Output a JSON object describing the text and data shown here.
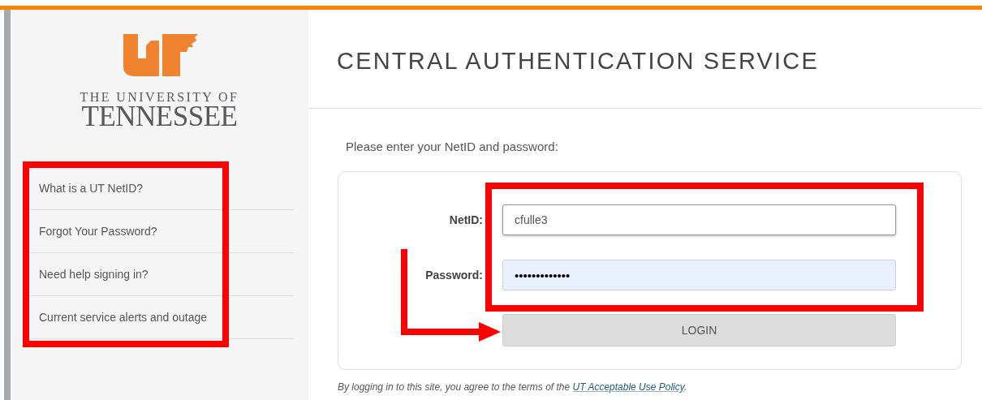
{
  "logo": {
    "line_1": "THE UNIVERSITY OF",
    "line_2": "TENNESSEE"
  },
  "help_links": {
    "highlighted": true,
    "items": [
      {
        "label": "What is a UT NetID?"
      },
      {
        "label": "Forgot Your Password?"
      },
      {
        "label": "Need help signing in?"
      },
      {
        "label": "Current service alerts and outage"
      }
    ]
  },
  "header": {
    "title": "CENTRAL AUTHENTICATION SERVICE"
  },
  "prompt": "Please enter your NetID and password:",
  "login_form": {
    "highlighted": true,
    "fields": [
      {
        "label": "NetID:",
        "value": "cfulle3",
        "kind": "text",
        "autofilled": false
      },
      {
        "label": "Password:",
        "value": "•••••••••••••",
        "kind": "password",
        "autofilled": true
      }
    ],
    "button": {
      "label": "LOGIN",
      "pointed_at": true
    }
  },
  "footer": {
    "text": "By logging in to this site, you agree to the terms of the ",
    "link": "UT Acceptable Use Policy",
    "end": "."
  }
}
